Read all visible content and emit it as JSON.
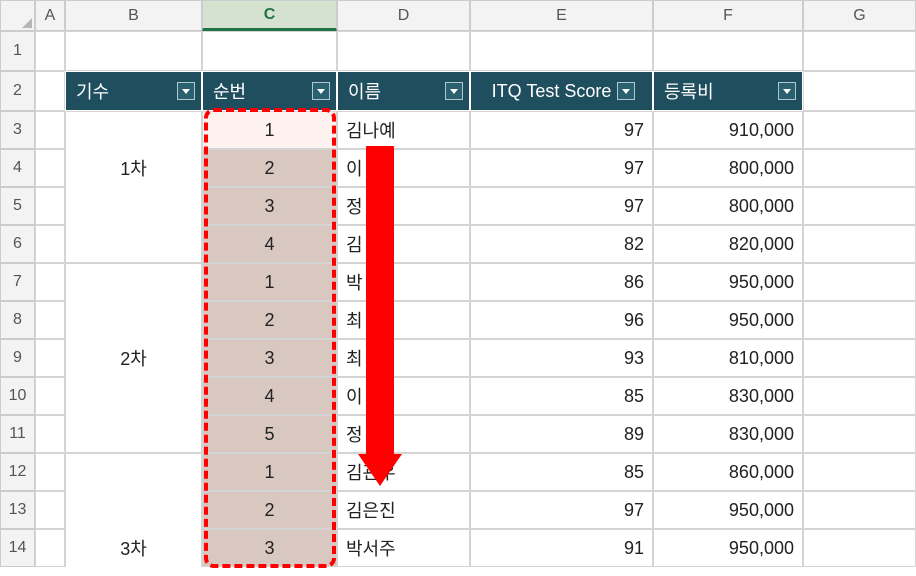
{
  "columns": [
    "A",
    "B",
    "C",
    "D",
    "E",
    "F",
    "G"
  ],
  "rows": [
    "1",
    "2",
    "3",
    "4",
    "5",
    "6",
    "7",
    "8",
    "9",
    "10",
    "11",
    "12",
    "13",
    "14"
  ],
  "headers": {
    "b": "기수",
    "c": "순번",
    "d": "이름",
    "e": "ITQ Test Score",
    "f": "등록비"
  },
  "tableRows": [
    {
      "gisu": "1차",
      "no": "1",
      "name": "김나예",
      "score": "97",
      "fee": "910,000"
    },
    {
      "gisu": "",
      "no": "2",
      "name": "이   진",
      "score": "97",
      "fee": "800,000"
    },
    {
      "gisu": "",
      "no": "3",
      "name": "정   이",
      "score": "97",
      "fee": "800,000"
    },
    {
      "gisu": "",
      "no": "4",
      "name": "김   빈",
      "score": "82",
      "fee": "820,000"
    },
    {
      "gisu": "2차",
      "no": "1",
      "name": "박   원",
      "score": "86",
      "fee": "950,000"
    },
    {
      "gisu": "",
      "no": "2",
      "name": "최   호",
      "score": "96",
      "fee": "950,000"
    },
    {
      "gisu": "",
      "no": "3",
      "name": "최   망",
      "score": "93",
      "fee": "810,000"
    },
    {
      "gisu": "",
      "no": "4",
      "name": "이   서",
      "score": "85",
      "fee": "830,000"
    },
    {
      "gisu": "",
      "no": "5",
      "name": "정   온",
      "score": "89",
      "fee": "830,000"
    },
    {
      "gisu": "3차",
      "no": "1",
      "name": "김관우",
      "score": "85",
      "fee": "860,000"
    },
    {
      "gisu": "",
      "no": "2",
      "name": "김은진",
      "score": "97",
      "fee": "950,000"
    },
    {
      "gisu": "",
      "no": "3",
      "name": "박서주",
      "score": "91",
      "fee": "950,000"
    }
  ],
  "chart_data": {
    "type": "table",
    "columns": [
      "기수",
      "순번",
      "이름",
      "ITQ Test Score",
      "등록비"
    ],
    "rows": [
      [
        "1차",
        1,
        "김나예",
        97,
        910000
      ],
      [
        "1차",
        2,
        "이 진",
        97,
        800000
      ],
      [
        "1차",
        3,
        "정 이",
        97,
        800000
      ],
      [
        "1차",
        4,
        "김 빈",
        82,
        820000
      ],
      [
        "2차",
        1,
        "박 원",
        86,
        950000
      ],
      [
        "2차",
        2,
        "최 호",
        96,
        950000
      ],
      [
        "2차",
        3,
        "최 망",
        93,
        810000
      ],
      [
        "2차",
        4,
        "이 서",
        85,
        830000
      ],
      [
        "2차",
        5,
        "정 온",
        89,
        830000
      ],
      [
        "3차",
        1,
        "김관우",
        85,
        860000
      ],
      [
        "3차",
        2,
        "김은진",
        97,
        950000
      ],
      [
        "3차",
        3,
        "박서주",
        91,
        950000
      ]
    ]
  }
}
